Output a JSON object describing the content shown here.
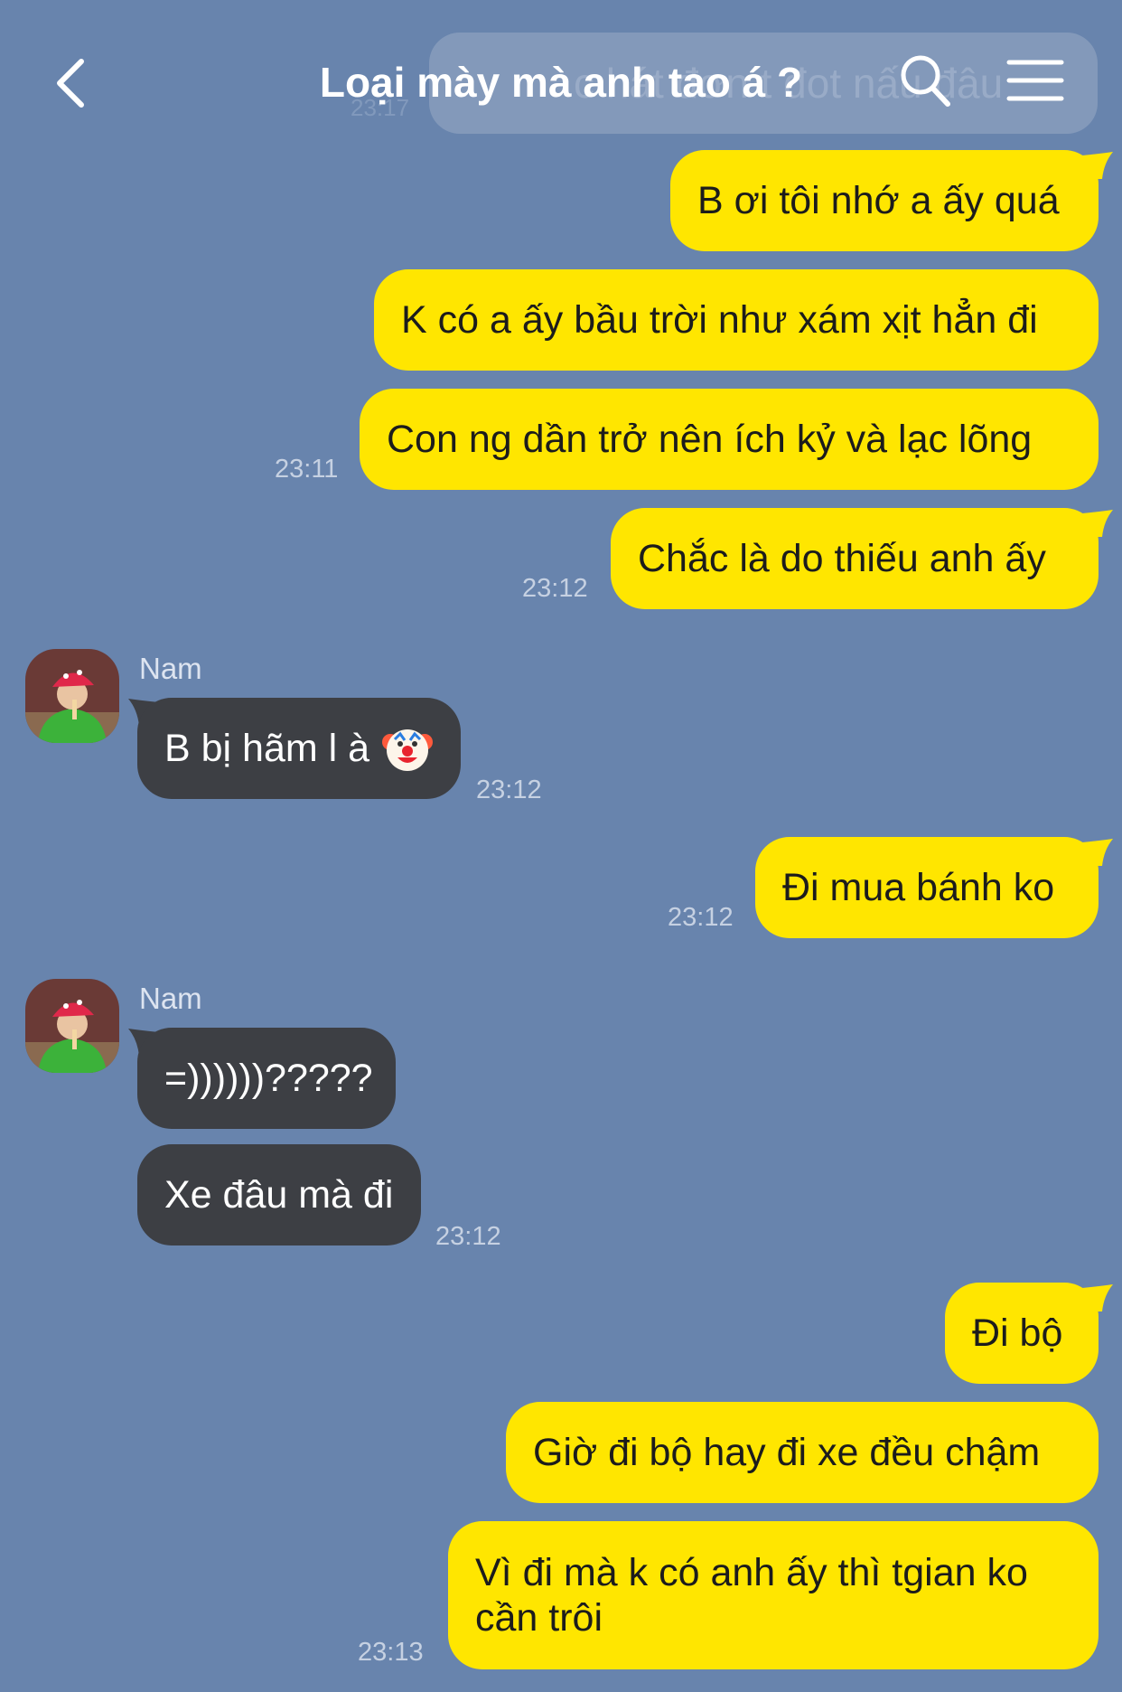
{
  "header": {
    "title": "Loại mày mà anh tao á ?",
    "ghost_text": "c hát đơn t đot nấu đâu",
    "ghost_time": "23:17"
  },
  "messages": {
    "m1": {
      "text": "B ơi tôi nhớ a ấy quá"
    },
    "m2": {
      "text": "K có a ấy bầu trời như xám xịt hẳn đi"
    },
    "m3": {
      "text": "Con ng dần trở nên ích kỷ và lạc lõng",
      "time": "23:11"
    },
    "m4": {
      "text": "Chắc là do thiếu anh ấy",
      "time": "23:12"
    },
    "m5": {
      "sender": "Nam",
      "text": "B bị hãm l à",
      "emoji": "clown-emoji",
      "time": "23:12"
    },
    "m6": {
      "text": "Đi mua bánh ko",
      "time": "23:12"
    },
    "m7": {
      "sender": "Nam",
      "text": "=))))))?????"
    },
    "m8": {
      "text": "Xe đâu mà đi",
      "time": "23:12"
    },
    "m9": {
      "text": "Đi bộ"
    },
    "m10": {
      "text": "Giờ đi bộ hay đi xe đều chậm"
    },
    "m11": {
      "text": "Vì đi mà k có anh ấy thì tgian ko cần trôi",
      "time": "23:13"
    }
  },
  "colors": {
    "background": "#6884ad",
    "my_bubble": "#ffe600",
    "their_bubble": "#3d3f44",
    "timestamp": "#c6d1e2"
  },
  "icons": [
    "back-arrow-icon",
    "search-icon",
    "menu-icon",
    "clown-emoji"
  ]
}
